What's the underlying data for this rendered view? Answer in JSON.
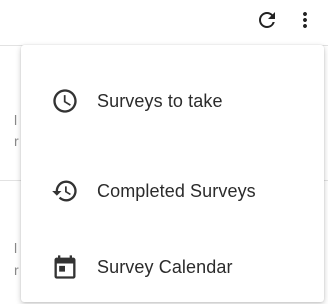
{
  "toolbar": {
    "refresh_icon": "refresh-icon",
    "more_icon": "more-vertical-icon"
  },
  "menu": {
    "items": [
      {
        "label": "Surveys to take",
        "icon": "clock-icon"
      },
      {
        "label": "Completed Surveys",
        "icon": "history-icon"
      },
      {
        "label": "Survey Calendar",
        "icon": "calendar-icon"
      }
    ]
  },
  "colors": {
    "icon": "#222222",
    "text": "#2b2b2b",
    "menu_bg": "#ffffff",
    "divider": "#e2e2e2"
  }
}
